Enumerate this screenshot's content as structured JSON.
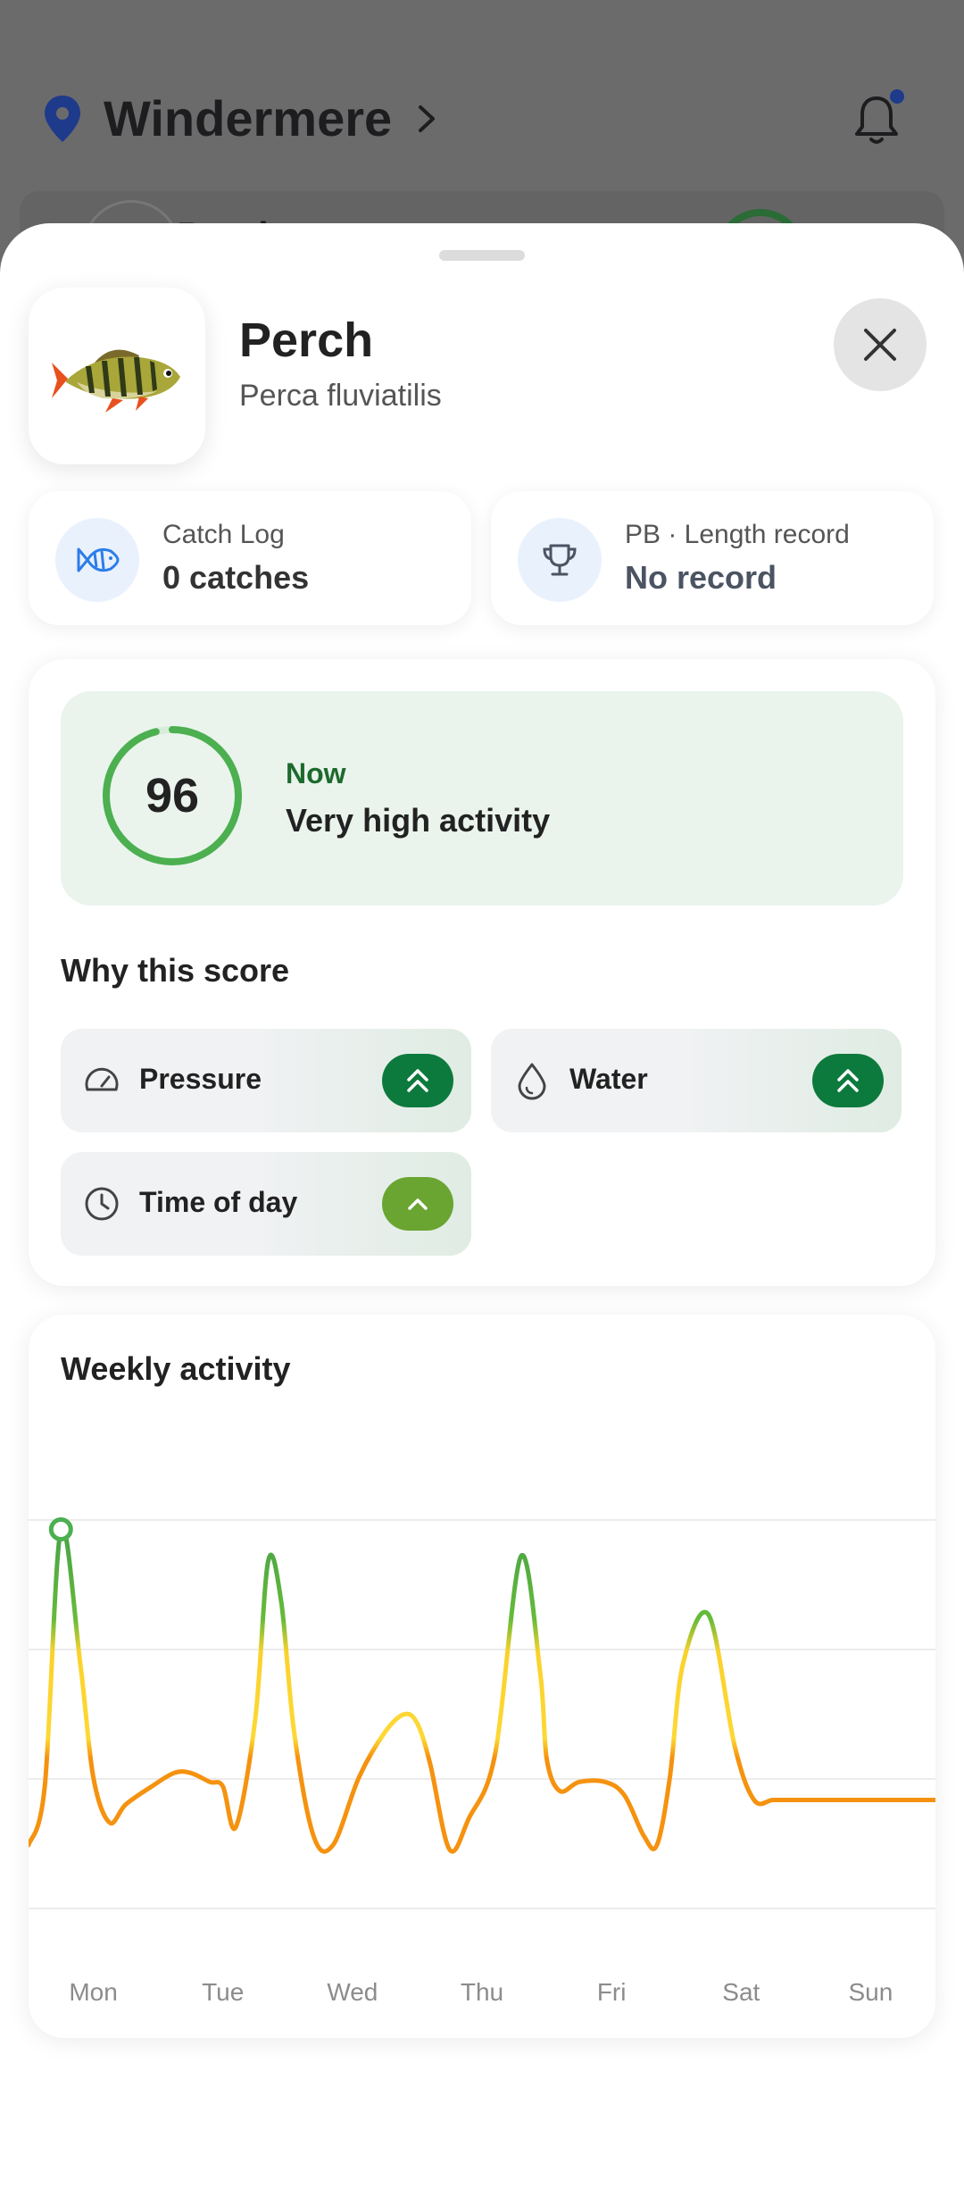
{
  "background": {
    "location_title": "Windermere",
    "card_title": "Perch"
  },
  "sheet": {
    "species_name": "Perch",
    "scientific_name": "Perca fluviatilis",
    "catch_log": {
      "label": "Catch Log",
      "value": "0 catches"
    },
    "pb": {
      "label": "PB · Length record",
      "value": "No record"
    },
    "score": {
      "value": "96",
      "fraction": 0.96,
      "now_label": "Now",
      "activity_text": "Very high activity",
      "why_title": "Why this score",
      "factors": [
        {
          "label": "Pressure",
          "icon": "gauge-icon",
          "level": "double-up",
          "badge_color": "#0d7a3d"
        },
        {
          "label": "Water",
          "icon": "water-drop-icon",
          "level": "double-up",
          "badge_color": "#0d7a3d"
        },
        {
          "label": "Time of day",
          "icon": "clock-icon",
          "level": "up",
          "badge_color": "#6aa532"
        }
      ]
    },
    "weekly": {
      "title": "Weekly activity"
    }
  },
  "colors": {
    "accent_green": "#4caf50",
    "dark_green": "#0d7a3d",
    "yellow": "#fdd835",
    "orange": "#f5920f",
    "icon_blue": "#2b7de9"
  },
  "chart_data": {
    "type": "line",
    "title": "Weekly activity",
    "categories": [
      "Mon",
      "Tue",
      "Wed",
      "Thu",
      "Fri",
      "Sat",
      "Sun"
    ],
    "x_range": [
      0,
      7
    ],
    "ylim": [
      0,
      100
    ],
    "grid": true,
    "series": [
      {
        "x": [
          0,
          0.125,
          0.25,
          0.4,
          0.5,
          0.625,
          0.75,
          0.95,
          1.125,
          1.25,
          1.4,
          1.5,
          1.6,
          1.75,
          1.85,
          1.95,
          2.05,
          2.2,
          2.35,
          2.55,
          2.75,
          2.9,
          3.0,
          3.1,
          3.25,
          3.4,
          3.6,
          3.8,
          3.95,
          4.0,
          4.1,
          4.25,
          4.45,
          4.6,
          4.75,
          4.85,
          4.95,
          5.05,
          5.25,
          5.45,
          5.6,
          5.75,
          5.95,
          6.15,
          6.3,
          6.5,
          6.63,
          6.78,
          7.0
        ],
        "values": [
          20,
          33,
          90,
          60,
          35,
          25,
          29,
          33,
          36,
          36,
          34,
          33,
          24,
          48,
          83,
          74,
          45,
          22,
          20,
          35,
          45,
          49,
          47,
          38,
          19,
          26,
          40,
          84,
          58,
          39,
          32,
          34,
          34,
          31,
          22,
          20,
          35,
          60,
          71,
          42,
          30,
          30,
          30,
          30,
          30,
          30,
          30,
          30,
          30
        ],
        "highlight_index": 2
      }
    ]
  }
}
